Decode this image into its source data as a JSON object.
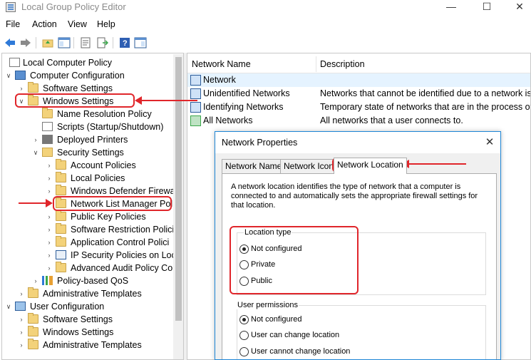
{
  "window": {
    "title": "Local Group Policy Editor",
    "minimize": "—",
    "maximize": "☐",
    "close": "✕"
  },
  "menu": [
    "File",
    "Action",
    "View",
    "Help"
  ],
  "toolbar_icons": [
    "back-icon",
    "forward-icon",
    "up-folder-icon",
    "show-hide-tree-icon",
    "properties-icon",
    "export-list-icon",
    "help-icon",
    "show-pane-icon"
  ],
  "tree": [
    {
      "label": "Local Computer Policy",
      "expander": "",
      "icon": "policy-icon"
    },
    {
      "label": "Computer Configuration",
      "expander": "∨",
      "icon": "computer-icon"
    },
    {
      "label": "Software Settings",
      "expander": "›",
      "icon": "folder-icon"
    },
    {
      "label": "Windows Settings",
      "expander": "∨",
      "icon": "folder-icon"
    },
    {
      "label": "Name Resolution Policy",
      "expander": "",
      "icon": "folder-icon"
    },
    {
      "label": "Scripts (Startup/Shutdown)",
      "expander": "",
      "icon": "script-icon"
    },
    {
      "label": "Deployed Printers",
      "expander": "›",
      "icon": "printer-icon"
    },
    {
      "label": "Security Settings",
      "expander": "∨",
      "icon": "security-icon"
    },
    {
      "label": "Account Policies",
      "expander": "›",
      "icon": "folder-icon"
    },
    {
      "label": "Local Policies",
      "expander": "›",
      "icon": "folder-icon"
    },
    {
      "label": "Windows Defender Firewa",
      "expander": "›",
      "icon": "folder-icon"
    },
    {
      "label": "Network List Manager Pol",
      "expander": "",
      "icon": "folder-icon"
    },
    {
      "label": "Public Key Policies",
      "expander": "›",
      "icon": "folder-icon"
    },
    {
      "label": "Software Restriction Polici",
      "expander": "›",
      "icon": "folder-icon"
    },
    {
      "label": "Application Control Polici",
      "expander": "›",
      "icon": "folder-icon"
    },
    {
      "label": "IP Security Policies on Loc",
      "expander": "›",
      "icon": "ipsec-icon"
    },
    {
      "label": "Advanced Audit Policy Co",
      "expander": "›",
      "icon": "folder-icon"
    },
    {
      "label": "Policy-based QoS",
      "expander": "›",
      "icon": "chart-icon"
    },
    {
      "label": "Administrative Templates",
      "expander": "›",
      "icon": "folder-icon"
    },
    {
      "label": "User Configuration",
      "expander": "∨",
      "icon": "user-icon"
    },
    {
      "label": "Software Settings",
      "expander": "›",
      "icon": "folder-icon"
    },
    {
      "label": "Windows Settings",
      "expander": "›",
      "icon": "folder-icon"
    },
    {
      "label": "Administrative Templates",
      "expander": "›",
      "icon": "folder-icon"
    }
  ],
  "list": {
    "columns": [
      "Network Name",
      "Description"
    ],
    "rows": [
      {
        "name": "Network",
        "description": ""
      },
      {
        "name": "Unidentified Networks",
        "description": "Networks that cannot be identified due to a network issu"
      },
      {
        "name": "Identifying Networks",
        "description": "Temporary state of networks that are in the process of be"
      },
      {
        "name": "All Networks",
        "description": "All networks that a user connects to."
      }
    ]
  },
  "dialog": {
    "title": "Network Properties",
    "close": "✕",
    "tabs": [
      "Network Name",
      "Network Icon",
      "Network Location"
    ],
    "active_tab": "Network Location",
    "description": "A network location identifies the type of network that a computer is connected to and automatically sets the appropriate firewall settings for that location.",
    "location_type": {
      "label": "Location type",
      "options": [
        "Not configured",
        "Private",
        "Public"
      ],
      "selected": "Not configured"
    },
    "user_permissions": {
      "label": "User permissions",
      "options": [
        "Not configured",
        "User can change location",
        "User cannot change location"
      ],
      "selected": "Not configured"
    }
  },
  "colors": {
    "annotation_red": "#e0262b",
    "selection_blue": "#e5f3ff",
    "dialog_border": "#1e86d6"
  }
}
